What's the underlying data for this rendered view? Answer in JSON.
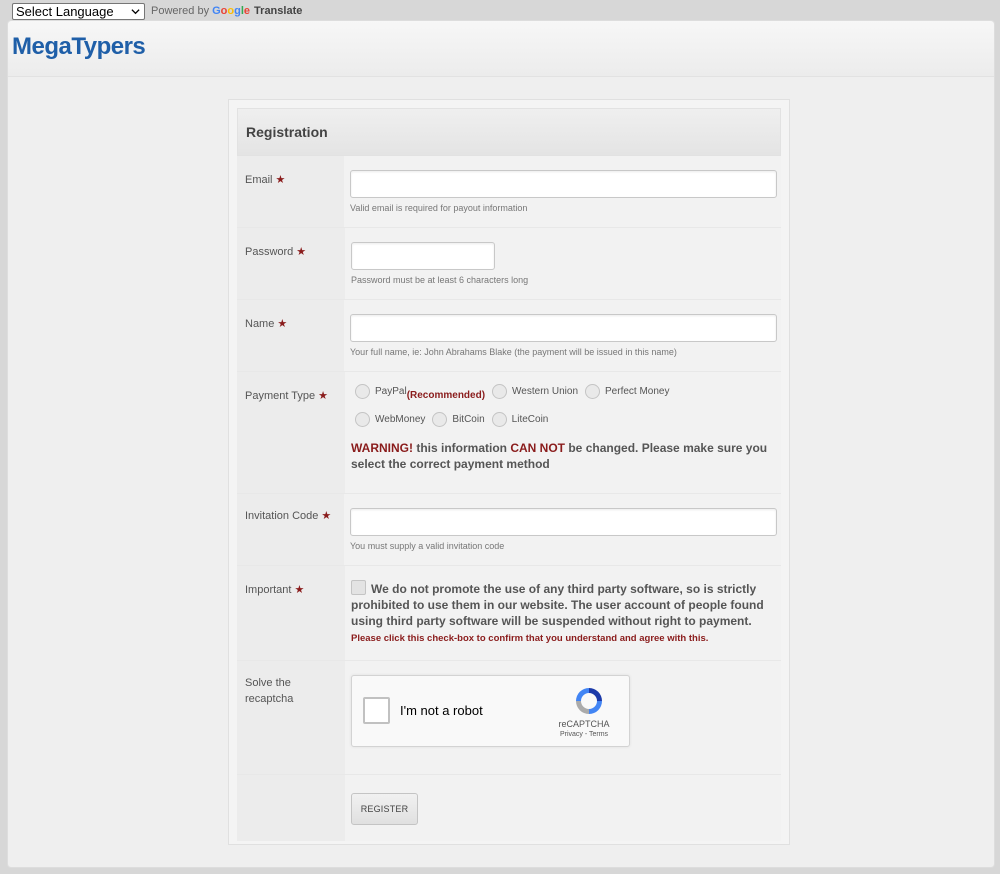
{
  "translate": {
    "select_label": "Select Language",
    "powered_by": "Powered by",
    "google": [
      "G",
      "o",
      "o",
      "g",
      "l",
      "e"
    ],
    "translate_label": "Translate"
  },
  "logo": {
    "text": "MegaTypers",
    "color": "#1f5fa8"
  },
  "form": {
    "title": "Registration",
    "email": {
      "label": "Email",
      "value": "",
      "hint": "Valid email is required for payout information"
    },
    "password": {
      "label": "Password",
      "value": "",
      "hint": "Password must be at least 6 characters long"
    },
    "name": {
      "label": "Name",
      "value": "",
      "hint": "Your full name, ie: John Abrahams Blake (the payment will be issued in this name)"
    },
    "payment": {
      "label": "Payment Type",
      "options": [
        "PayPal",
        "Western Union",
        "Perfect Money",
        "WebMoney",
        "BitCoin",
        "LiteCoin"
      ],
      "recommended": "(Recommended)",
      "warning_prefix": "WARNING!",
      "warning_mid": " this information ",
      "warning_cannot": "CAN NOT",
      "warning_suffix": " be changed. Please make sure you select the correct payment method"
    },
    "invitation": {
      "label": "Invitation Code",
      "value": "",
      "hint": "You must supply a valid invitation code"
    },
    "important": {
      "label": "Important",
      "text": "We do not promote the use of any third party software, so is strictly prohibited to use them in our website. The user account of people found using third party software will be suspended without right to payment.",
      "confirm": "Please click this check-box to confirm that you understand and agree with this."
    },
    "captcha": {
      "label": "Solve the recaptcha",
      "text": "I'm not a robot",
      "brand": "reCAPTCHA",
      "privacy": "Privacy",
      "separator": " - ",
      "terms": "Terms"
    },
    "register_label": "REGISTER"
  },
  "colors": {
    "required_star": "#8a1c1c",
    "warning_red": "#8a1c1c"
  }
}
